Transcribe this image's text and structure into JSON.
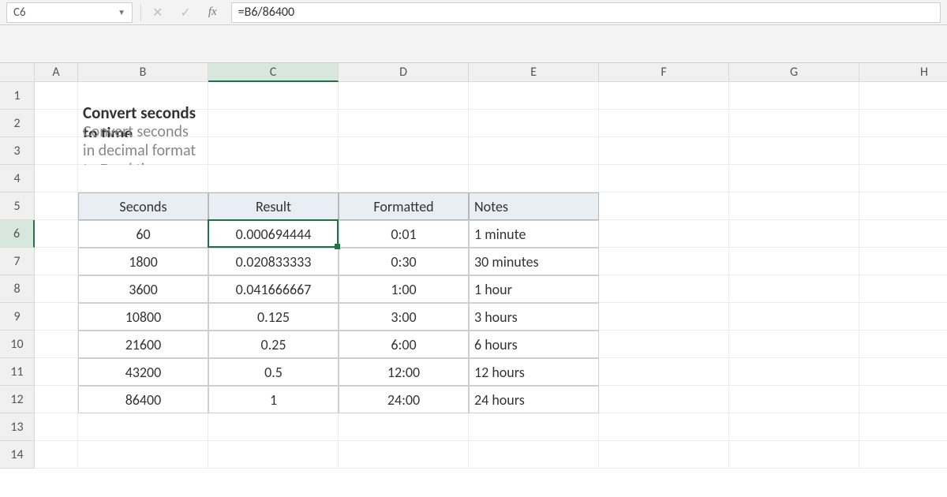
{
  "nameBox": "C6",
  "formula": "=B6/86400",
  "columns": [
    "A",
    "B",
    "C",
    "D",
    "E",
    "F",
    "G",
    "H"
  ],
  "activeCol": "C",
  "rows": [
    "1",
    "2",
    "3",
    "4",
    "5",
    "6",
    "7",
    "8",
    "9",
    "10",
    "11",
    "12",
    "13",
    "14"
  ],
  "activeRow": "6",
  "title": "Convert seconds to time",
  "subtitle": "Convert seconds in decimal format to Excel time",
  "headers": {
    "b": "Seconds",
    "c": "Result",
    "d": "Formatted",
    "e": "Notes"
  },
  "data": [
    {
      "sec": "60",
      "res": "0.000694444",
      "fmt": "0:01",
      "note": "1 minute"
    },
    {
      "sec": "1800",
      "res": "0.020833333",
      "fmt": "0:30",
      "note": "30 minutes"
    },
    {
      "sec": "3600",
      "res": "0.041666667",
      "fmt": "1:00",
      "note": "1 hour"
    },
    {
      "sec": "10800",
      "res": "0.125",
      "fmt": "3:00",
      "note": "3 hours"
    },
    {
      "sec": "21600",
      "res": "0.25",
      "fmt": "6:00",
      "note": "6 hours"
    },
    {
      "sec": "43200",
      "res": "0.5",
      "fmt": "12:00",
      "note": "12 hours"
    },
    {
      "sec": "86400",
      "res": "1",
      "fmt": "24:00",
      "note": "24 hours"
    }
  ]
}
